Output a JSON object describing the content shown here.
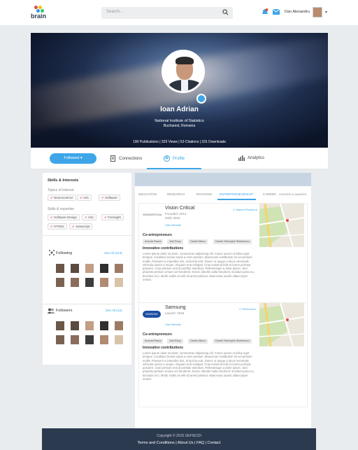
{
  "brand": {
    "name": "brain",
    "dot_colors": [
      "#e74c3c",
      "#f1c40f",
      "#3498db",
      "#2ecc71"
    ]
  },
  "header": {
    "search_placeholder": "Search...",
    "user_name": "Dan Alexandru"
  },
  "profile": {
    "name": "Ioan Adrian",
    "institution": "National Institute of Statistics",
    "location": "Bucharest, Romania",
    "stats": "190 Publications | 329 Views | 53 Citations | 331 Downloads"
  },
  "tabs": {
    "followed": "Followed",
    "connections": "Connections",
    "profile": "Profile",
    "analytics": "Analytics"
  },
  "skills": {
    "title": "Skills & Interests",
    "topics_label": "Topics of interest",
    "topics": [
      "Neuroscience",
      "Arts",
      "Software"
    ],
    "skills_label": "Skills & expertise",
    "skills": [
      "Software Design",
      "Arts",
      "Foresight",
      "HTML5",
      "Javascript"
    ]
  },
  "following": {
    "title": "Following",
    "see_all": "See All (213)"
  },
  "followers": {
    "title": "Followers",
    "see_all": "See All (13)"
  },
  "profile_tabs": [
    "EDUCATION",
    "RESEARCH",
    "TEACHING",
    "ENTREPRENEURSHIP",
    "CAREER",
    "HONORS & AWARDS"
  ],
  "companies": [
    {
      "name": "Vision Critical",
      "logo": "VISIONCRITICAL",
      "founded": "Founded: 2014",
      "sold": "Sold: 2016",
      "website": "Visit Website",
      "field": "Market Research",
      "coent_title": "Co-entrepreneurs",
      "coentrepreneurs": [
        "Ancuta Pasca",
        "Joel Rovy",
        "Daniel Marcu",
        "Daniel Gheorghe Stefanescu"
      ],
      "contrib_title": "Innovative contributions",
      "body": "Lorem ipsum dolor sit amet, consectetur adipiscing elit. Fusce auctor ut tellus eget tempus. Curabitur lacinia turpis a enim pretium. Maecenas vestibulum mi vel pretium mollis. Praesent a imperdiet nisi, at lacinia erat. Donec ut augue a lacus venenatis vehicula auctor a neque. Aliquam erat volutpat. Cras euismod felis et lorem pulvinar posuere. Cras pretium erat id porttitor interdum. Pellentesque a dolor ipsum. Sed pharetra pretium ornare vel hendrerit. Donec lobortis nulla hendrerit, tincidunt justo eu, tincidunt orci. Morbi mollis at velit sit amet pulvinar. Maecenas iaculis ullamcorper ornare."
    },
    {
      "name": "Samsung",
      "logo": "SAMSUNG",
      "founded": "Launch: 2016",
      "sold": "",
      "website": "Visit Website",
      "field": "Electronics",
      "coent_title": "Co-entrepreneurs",
      "coentrepreneurs": [
        "Ancuta Pasca",
        "Joel Rovy",
        "Daniel Marcu",
        "Daniel Gheorghe Stefanescu"
      ],
      "contrib_title": "Innovative contributions",
      "body": "Lorem ipsum dolor sit amet, consectetur adipiscing elit. Fusce auctor ut tellus eget tempus. Curabitur lacinia turpis a enim pretium. Maecenas vestibulum mi vel pretium mollis. Praesent a imperdiet nisi, at lacinia erat. Donec ut augue a lacus venenatis vehicula auctor a neque. Aliquam erat volutpat. Cras euismod felis et lorem pulvinar posuere. Cras pretium erat id porttitor interdum. Pellentesque a dolor ipsum. Sed pharetra pretium ornare vel hendrerit. Donec lobortis nulla hendrerit, tincidunt justo eu, tincidunt orci. Morbi mollis at velit sit amet pulvinar. Maecenas iaculis ullamcorper ornare."
    }
  ],
  "footer": {
    "copyright": "Copyright © 2015 UEFISCDI",
    "links": "Terms and Conditions  |  About Us  |  FAQ  |  Contact"
  },
  "colors": {
    "accent": "#3da5e8",
    "footer": "#2b3a4f",
    "tag_icon": "#e74c3c"
  }
}
